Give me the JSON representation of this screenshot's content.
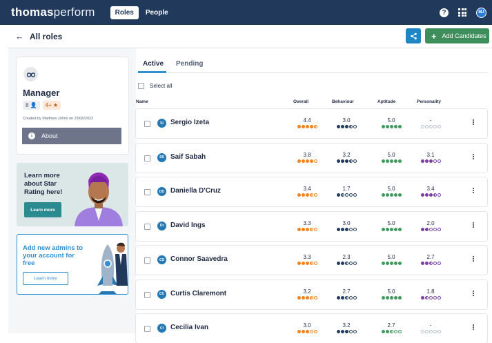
{
  "app": {
    "brand_bold": "thomas",
    "brand_light": "perform",
    "nav": {
      "roles": "Roles",
      "people": "People"
    },
    "user_initials": "MJ"
  },
  "subbar": {
    "back_label": "All roles",
    "add_candidates_label": "Add Candidates"
  },
  "role": {
    "title": "Manager",
    "people_count": "8",
    "star_filter": "4+",
    "created": "Created by Matthew Johns on 23/06/2022",
    "about_label": "About"
  },
  "promo_star": {
    "text": "Learn more about Star Rating here!",
    "button": "Learn more"
  },
  "promo_admin": {
    "text": "Add new admins to your account for free",
    "button": "Learn more"
  },
  "tabs": {
    "active": "Active",
    "pending": "Pending"
  },
  "select_all_label": "Select all",
  "columns": {
    "name": "Name",
    "overall": "Overall",
    "behaviour": "Behaviour",
    "aptitude": "Aptitude",
    "personality": "Personality"
  },
  "colors": {
    "overall": "#f0831f",
    "behaviour": "#213a5c",
    "aptitude": "#3e9a5e",
    "personality": "#7b3fa3"
  },
  "candidates": [
    {
      "initials": "SI",
      "name": "Sergio Izeta",
      "overall": "4.4",
      "overall_dots": 4.5,
      "behaviour": "3.0",
      "behaviour_dots": 3.5,
      "aptitude": "5.0",
      "aptitude_dots": 5,
      "personality": "-",
      "personality_dots": 0
    },
    {
      "initials": "SS",
      "name": "Saif Sabah",
      "overall": "3.8",
      "overall_dots": 4,
      "behaviour": "3.2",
      "behaviour_dots": 3.5,
      "aptitude": "5.0",
      "aptitude_dots": 5,
      "personality": "3.1",
      "personality_dots": 3
    },
    {
      "initials": "DD",
      "name": "Daniella D'Cruz",
      "overall": "3.4",
      "overall_dots": 3.5,
      "behaviour": "1.7",
      "behaviour_dots": 1.5,
      "aptitude": "5.0",
      "aptitude_dots": 5,
      "personality": "3.4",
      "personality_dots": 3.5
    },
    {
      "initials": "DI",
      "name": "David Ings",
      "overall": "3.3",
      "overall_dots": 3.5,
      "behaviour": "3.0",
      "behaviour_dots": 3,
      "aptitude": "5.0",
      "aptitude_dots": 5,
      "personality": "2.0",
      "personality_dots": 2
    },
    {
      "initials": "CS",
      "name": "Connor Saavedra",
      "overall": "3.3",
      "overall_dots": 3.5,
      "behaviour": "2.3",
      "behaviour_dots": 2.5,
      "aptitude": "5.0",
      "aptitude_dots": 5,
      "personality": "2.7",
      "personality_dots": 2.5
    },
    {
      "initials": "CC",
      "name": "Curtis Claremont",
      "overall": "3.2",
      "overall_dots": 3.5,
      "behaviour": "2.7",
      "behaviour_dots": 2.5,
      "aptitude": "5.0",
      "aptitude_dots": 5,
      "personality": "1.8",
      "personality_dots": 1.5
    },
    {
      "initials": "CI",
      "name": "Cecilia Ivan",
      "overall": "3.0",
      "overall_dots": 3,
      "behaviour": "3.2",
      "behaviour_dots": 3,
      "aptitude": "2.7",
      "aptitude_dots": 2.5,
      "personality": "-",
      "personality_dots": 0
    }
  ]
}
